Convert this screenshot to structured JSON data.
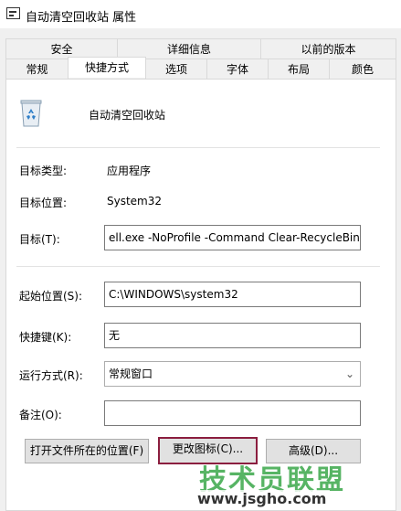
{
  "window": {
    "title": "自动清空回收站 属性"
  },
  "tabs_row1": [
    {
      "label": "安全"
    },
    {
      "label": "详细信息"
    },
    {
      "label": "以前的版本"
    }
  ],
  "tabs_row2": [
    {
      "label": "常规"
    },
    {
      "label": "快捷方式"
    },
    {
      "label": "选项"
    },
    {
      "label": "字体"
    },
    {
      "label": "布局"
    },
    {
      "label": "颜色"
    }
  ],
  "shortcut": {
    "name": "自动清空回收站",
    "target_type_label": "目标类型:",
    "target_type_value": "应用程序",
    "target_location_label": "目标位置:",
    "target_location_value": "System32",
    "target_label": "目标(T):",
    "target_value": "ell.exe -NoProfile -Command Clear-RecycleBin\"",
    "start_in_label": "起始位置(S):",
    "start_in_value": "C:\\WINDOWS\\system32",
    "hotkey_label": "快捷键(K):",
    "hotkey_value": "无",
    "run_label": "运行方式(R):",
    "run_value": "常规窗口",
    "comment_label": "备注(O):",
    "comment_value": ""
  },
  "buttons": {
    "open_location": "打开文件所在的位置(F)",
    "change_icon": "更改图标(C)...",
    "advanced": "高级(D)..."
  },
  "watermark": {
    "text": "技术员联盟",
    "url": "www.jsgho.com"
  },
  "colors": {
    "focus_border": "#8b1e3f",
    "watermark": "#3aa84a"
  }
}
